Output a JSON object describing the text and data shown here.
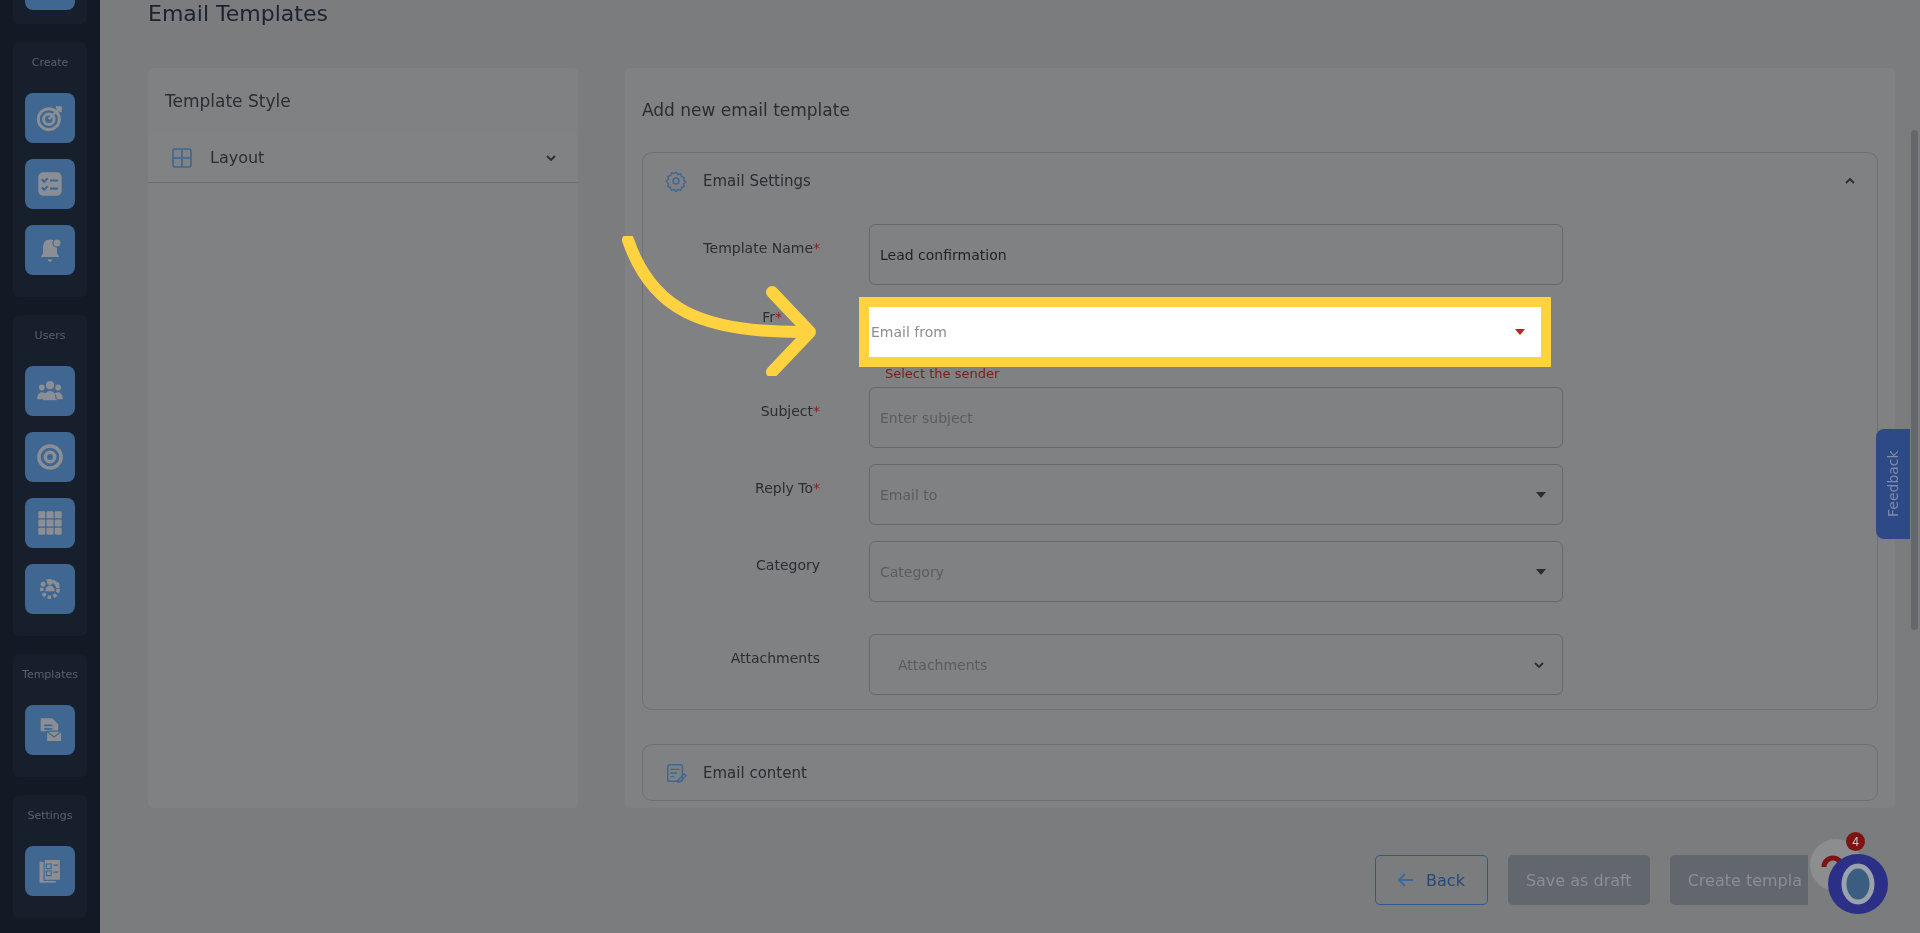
{
  "page": {
    "title": "Email Templates"
  },
  "sidebar": {
    "groups": [
      {
        "items": [
          {
            "kind": "partial"
          }
        ]
      },
      {
        "label": "Create",
        "items": [
          {
            "kind": "target"
          },
          {
            "kind": "checklist"
          },
          {
            "kind": "bell"
          }
        ]
      },
      {
        "label": "Users",
        "items": [
          {
            "kind": "users"
          },
          {
            "kind": "ring"
          },
          {
            "kind": "grid"
          },
          {
            "kind": "team-gear"
          }
        ]
      },
      {
        "label": "Templates",
        "items": [
          {
            "kind": "document-mail"
          }
        ]
      },
      {
        "label": "Settings",
        "items": [
          {
            "kind": "forms"
          }
        ]
      }
    ]
  },
  "template_style": {
    "title": "Template Style",
    "sections": [
      {
        "label": "Layout",
        "expanded": false
      }
    ]
  },
  "editor": {
    "title": "Add new email template",
    "accordions": [
      {
        "title": "Email Settings",
        "kind": "settings",
        "expanded": true,
        "fields": [
          {
            "label": "Template Name",
            "mark": "*",
            "kind": "text",
            "value": "Lead confirmation",
            "highlighted": false
          },
          {
            "label": "Fr",
            "mark": "*",
            "kind": "select",
            "placeholder": "Email from",
            "error": "Select the sender",
            "highlighted": true
          },
          {
            "label": "Subject",
            "mark": "*",
            "kind": "text",
            "placeholder": "Enter subject",
            "highlighted": false
          },
          {
            "label": "Reply To",
            "mark": "*",
            "kind": "select",
            "placeholder": "Email to",
            "highlighted": false
          },
          {
            "label": "Category",
            "kind": "select",
            "placeholder": "Category",
            "highlighted": false
          },
          {
            "label": "Attachments",
            "kind": "multiselect",
            "placeholder": "Attachments",
            "highlighted": false
          }
        ]
      },
      {
        "title": "Email content",
        "kind": "content",
        "expanded": false
      }
    ]
  },
  "actions": [
    {
      "label": "Back",
      "kind": "back",
      "disabled": false
    },
    {
      "label": "Save as draft",
      "kind": "plain",
      "disabled": true
    },
    {
      "label": "Create templa",
      "kind": "plain",
      "disabled": true
    }
  ],
  "feedback": {
    "label": "Feedback"
  },
  "chat": {
    "badge": "4"
  }
}
